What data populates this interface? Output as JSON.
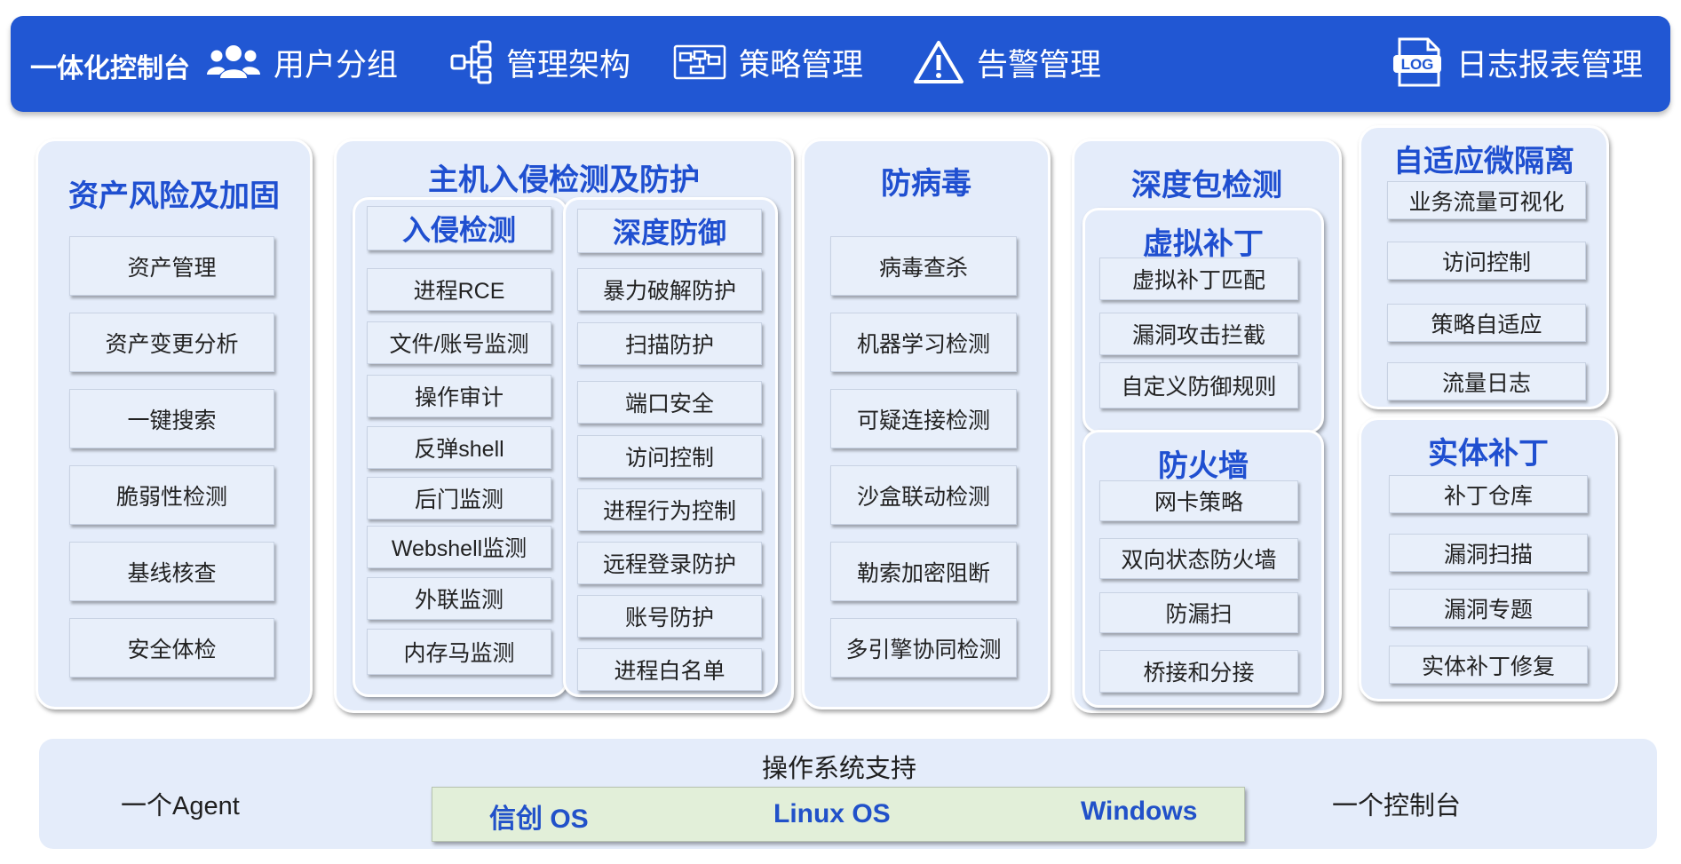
{
  "header": {
    "brand": "一体化控制台",
    "nav": [
      {
        "label": "用户分组",
        "icon": "users-icon"
      },
      {
        "label": "管理架构",
        "icon": "hierarchy-icon"
      },
      {
        "label": "策略管理",
        "icon": "flowchart-icon"
      },
      {
        "label": "告警管理",
        "icon": "warning-icon"
      },
      {
        "label": "日志报表管理",
        "icon": "log-file-icon",
        "icon_text": "LOG"
      }
    ]
  },
  "panels": {
    "asset": {
      "title": "资产风险及加固",
      "items": [
        "资产管理",
        "资产变更分析",
        "一键搜索",
        "脆弱性检测",
        "基线核查",
        "安全体检"
      ]
    },
    "hids": {
      "title": "主机入侵检测及防护",
      "intrusion": {
        "title": "入侵检测",
        "items": [
          "进程RCE",
          "文件/账号监测",
          "操作审计",
          "反弹shell",
          "后门监测",
          "Webshell监测",
          "外联监测",
          "内存马监测"
        ]
      },
      "defense": {
        "title": "深度防御",
        "items": [
          "暴力破解防护",
          "扫描防护",
          "端口安全",
          "访问控制",
          "进程行为控制",
          "远程登录防护",
          "账号防护",
          "进程白名单"
        ]
      }
    },
    "antivirus": {
      "title": "防病毒",
      "items": [
        "病毒查杀",
        "机器学习检测",
        "可疑连接检测",
        "沙盒联动检测",
        "勒索加密阻断",
        "多引擎协同检测"
      ]
    },
    "dpi": {
      "title": "深度包检测",
      "vpatch": {
        "title": "虚拟补丁",
        "items": [
          "虚拟补丁匹配",
          "漏洞攻击拦截",
          "自定义防御规则"
        ]
      },
      "firewall": {
        "title": "防火墙",
        "items": [
          "网卡策略",
          "双向状态防火墙",
          "防漏扫",
          "桥接和分接"
        ]
      }
    },
    "microseg": {
      "title": "自适应微隔离",
      "items": [
        "业务流量可视化",
        "访问控制",
        "策略自适应",
        "流量日志"
      ]
    },
    "patch": {
      "title": "实体补丁",
      "items": [
        "补丁仓库",
        "漏洞扫描",
        "漏洞专题",
        "实体补丁修复"
      ]
    }
  },
  "bottom": {
    "left_label": "一个Agent",
    "os_title": "操作系统支持",
    "os_list": [
      "信创 OS",
      "Linux OS",
      "Windows"
    ],
    "right_label": "一个控制台"
  },
  "colors": {
    "header_bg": "#2157d3",
    "accent_text": "#1f4fd0",
    "panel_bg": "#e4ecfa",
    "os_bar_bg": "#e2efd9"
  }
}
